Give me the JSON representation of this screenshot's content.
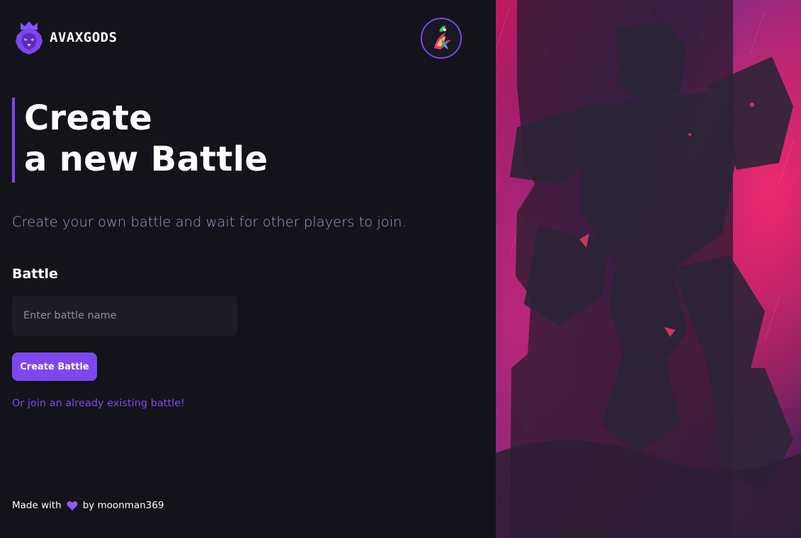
{
  "brand": {
    "name": "AVAXGODS"
  },
  "heading": {
    "line1": "Create",
    "line2": "a new Battle"
  },
  "subtitle": "Create your own battle and wait for other players to join.",
  "form": {
    "label": "Battle",
    "placeholder": "Enter battle name",
    "value": "",
    "submit_label": "Create Battle"
  },
  "join_link": "Or join an already existing battle!",
  "footer": {
    "made_with": "Made with",
    "by": "by moonman369"
  },
  "colors": {
    "accent": "#7f46f0",
    "background": "#13141a",
    "input_bg": "#1b1d25",
    "subtitle": "#8fa3c4"
  },
  "icons": {
    "logo": "lion-crown-icon",
    "avatar": "player-avatar",
    "heart": "heart-icon"
  }
}
